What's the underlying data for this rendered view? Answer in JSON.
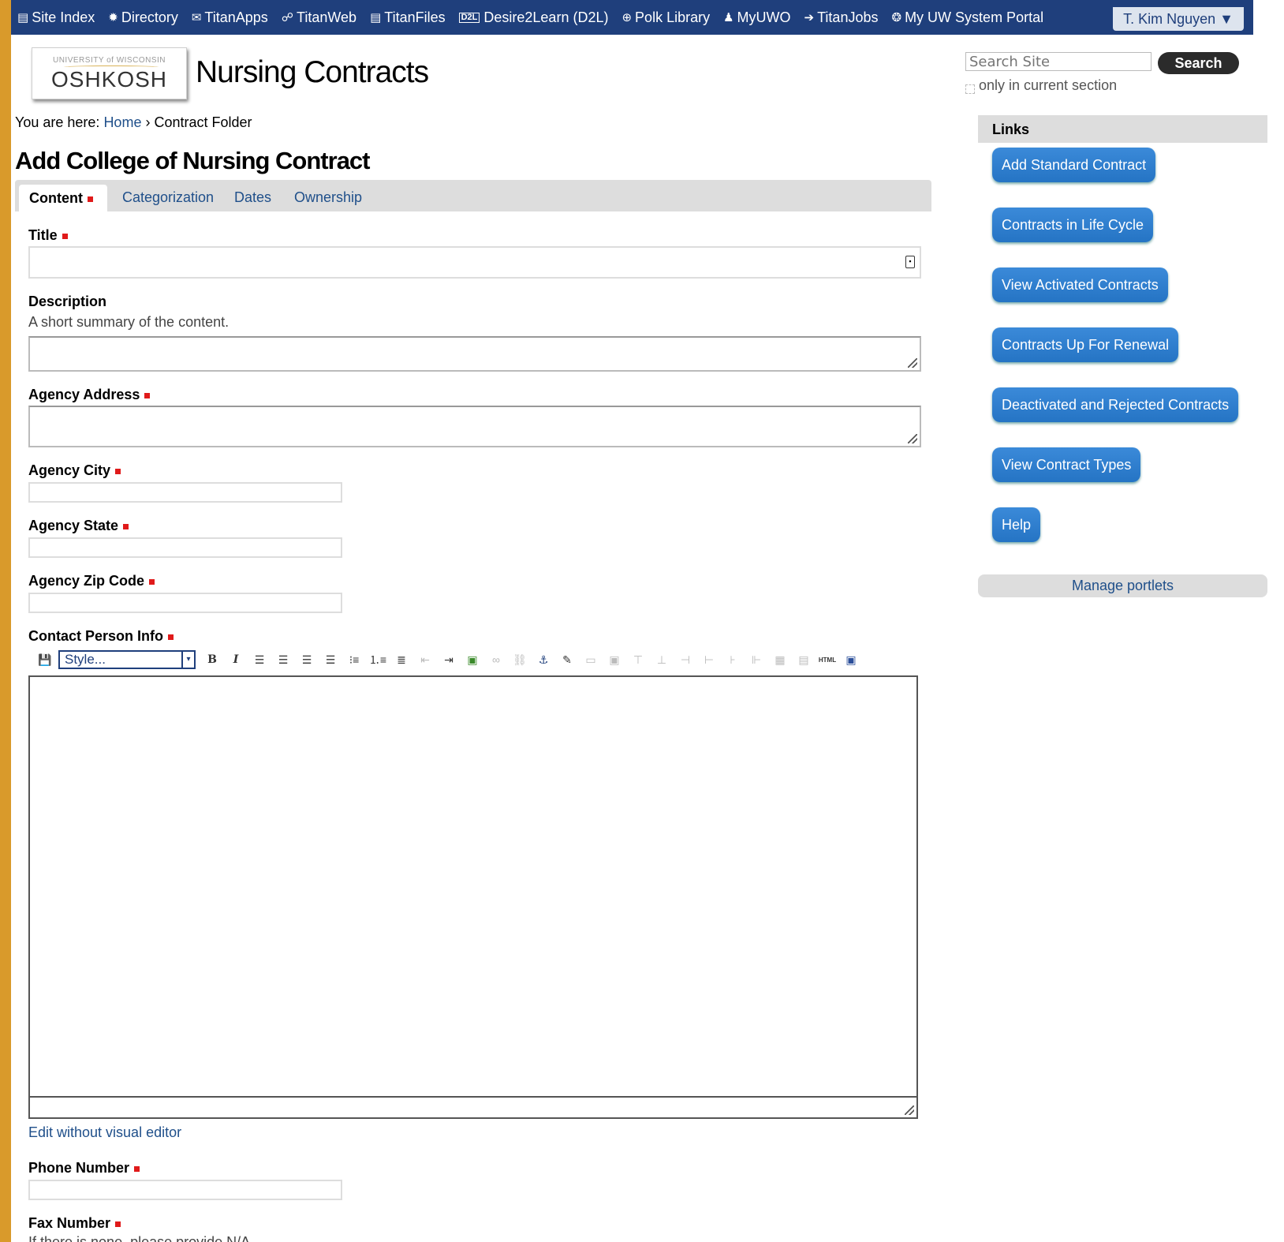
{
  "topbar": {
    "items": [
      {
        "icon": "page-icon",
        "glyph": "▤",
        "label": "Site Index"
      },
      {
        "icon": "gear-icon",
        "glyph": "✹",
        "label": "Directory"
      },
      {
        "icon": "mail-icon",
        "glyph": "✉",
        "label": "TitanApps"
      },
      {
        "icon": "web-icon",
        "glyph": "☍",
        "label": "TitanWeb"
      },
      {
        "icon": "file-icon",
        "glyph": "▤",
        "label": "TitanFiles"
      },
      {
        "icon": "d2l-icon",
        "glyph": "D2L",
        "label": "Desire2Learn (D2L)"
      },
      {
        "icon": "library-icon",
        "glyph": "⊕",
        "label": "Polk Library"
      },
      {
        "icon": "user-icon",
        "glyph": "♟",
        "label": "MyUWO"
      },
      {
        "icon": "jobs-icon",
        "glyph": "➔",
        "label": "TitanJobs"
      },
      {
        "icon": "portal-icon",
        "glyph": "❂",
        "label": "My UW System Portal"
      }
    ],
    "user_menu": "T. Kim Nguyen ▼"
  },
  "header": {
    "logo_small": "UNIVERSITY of WISCONSIN",
    "logo_main": "OSHKOSH",
    "site_title": "Nursing Contracts",
    "search_placeholder": "Search Site",
    "search_button": "Search",
    "section_only_label": "only in current section"
  },
  "breadcrumb": {
    "prefix": "You are here:",
    "home": "Home",
    "separator": "›",
    "current": "Contract Folder"
  },
  "page_title": "Add College of Nursing Contract",
  "tabs": [
    {
      "label": "Content",
      "active": true
    },
    {
      "label": "Categorization"
    },
    {
      "label": "Dates"
    },
    {
      "label": "Ownership"
    }
  ],
  "form": {
    "title_label": "Title",
    "description_label": "Description",
    "description_help": "A short summary of the content.",
    "agency_address_label": "Agency Address",
    "agency_city_label": "Agency City",
    "agency_state_label": "Agency State",
    "agency_zip_label": "Agency Zip Code",
    "contact_label": "Contact Person Info",
    "style_select": "Style...",
    "edit_plain": "Edit without visual editor",
    "phone_label": "Phone Number",
    "fax_label": "Fax Number",
    "fax_help": "If there is none, please provide N/A."
  },
  "sidebar": {
    "heading": "Links",
    "links": [
      "Add Standard Contract",
      "Contracts in Life Cycle",
      "View Activated Contracts",
      "Contracts Up For Renewal",
      "Deactivated and Rejected Contracts",
      "View Contract Types",
      "Help"
    ],
    "manage": "Manage portlets"
  },
  "colors": {
    "topbar_bg": "#1f3f7c",
    "page_border": "#d99a2b",
    "link": "#1f4f8a",
    "button_blue": "#2c7ccd",
    "required": "#e01a1a"
  }
}
